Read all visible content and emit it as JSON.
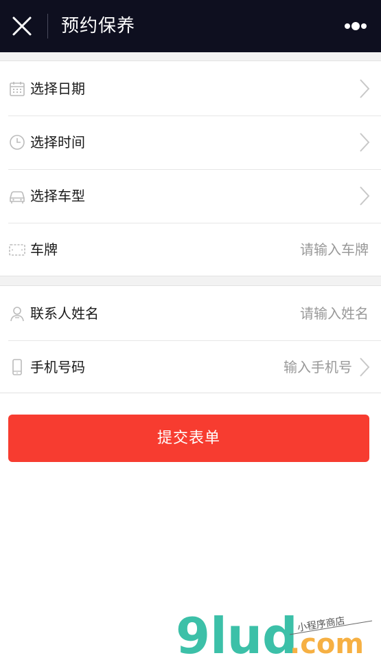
{
  "navbar": {
    "title": "预约保养",
    "close_icon": "close-icon",
    "more_icon": "more-dots-icon"
  },
  "form": {
    "date": {
      "label": "选择日期",
      "icon": "calendar-icon"
    },
    "time": {
      "label": "选择时间",
      "icon": "clock-icon"
    },
    "car_model": {
      "label": "选择车型",
      "icon": "car-icon"
    },
    "plate": {
      "label": "车牌",
      "placeholder": "请输入车牌",
      "icon": "license-plate-icon"
    },
    "contact_name": {
      "label": "联系人姓名",
      "placeholder": "请输入姓名",
      "icon": "person-icon"
    },
    "phone": {
      "label": "手机号码",
      "placeholder": "输入手机号",
      "icon": "phone-icon"
    }
  },
  "submit_label": "提交表单",
  "watermark": {
    "brand": "9lud",
    "domain": ".com",
    "tagline": "小程序商店"
  },
  "colors": {
    "navbar_bg": "#0e0f1f",
    "submit_bg": "#f73c30",
    "placeholder": "#999999",
    "watermark_teal": "#3cc0a8",
    "watermark_orange": "#f6b043"
  }
}
